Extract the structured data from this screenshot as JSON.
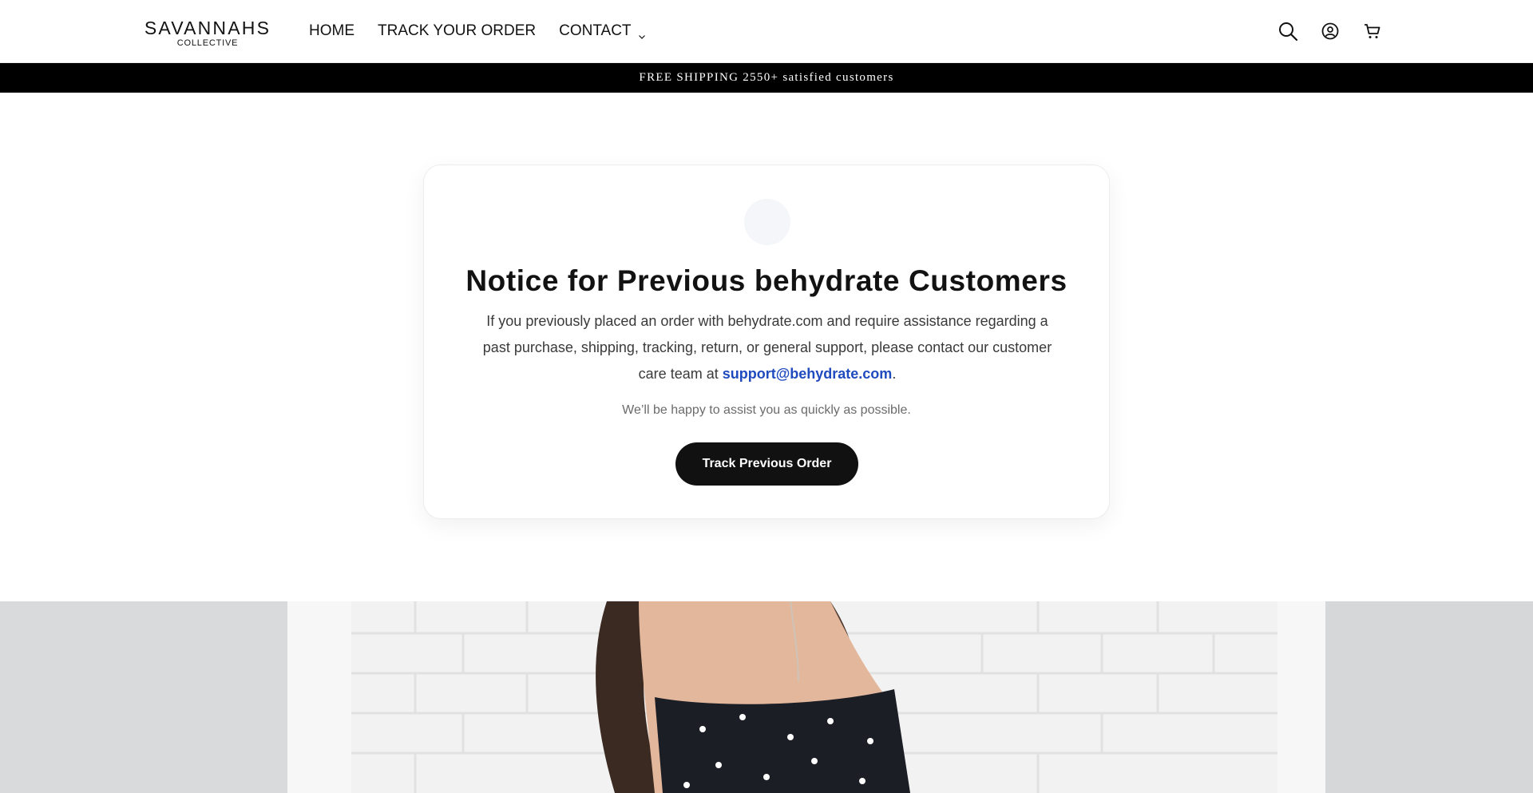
{
  "header": {
    "logo_main": "SAVANNAHS",
    "logo_sub": "COLLECTIVE",
    "nav": [
      {
        "label": "HOME"
      },
      {
        "label": "TRACK YOUR ORDER"
      },
      {
        "label": "CONTACT"
      }
    ],
    "icons": [
      "search-icon",
      "account-icon",
      "cart-icon"
    ]
  },
  "announcement": {
    "text": "FREE SHIPPING 2550+ satisfied customers"
  },
  "notice": {
    "title": "Notice for Previous behydrate Customers",
    "body_before": "If you previously placed an order with behydrate.com and require assistance regarding a past purchase, shipping, tracking, return, or general support, please contact our customer care team at ",
    "email": "support@behydrate.com",
    "body_after": ".",
    "note": "We’ll be happy to assist you as quickly as possible.",
    "button_label": "Track Previous Order"
  },
  "colors": {
    "announcement_bg": "#000000",
    "link": "#1f4bbf",
    "button_bg": "#111111"
  }
}
